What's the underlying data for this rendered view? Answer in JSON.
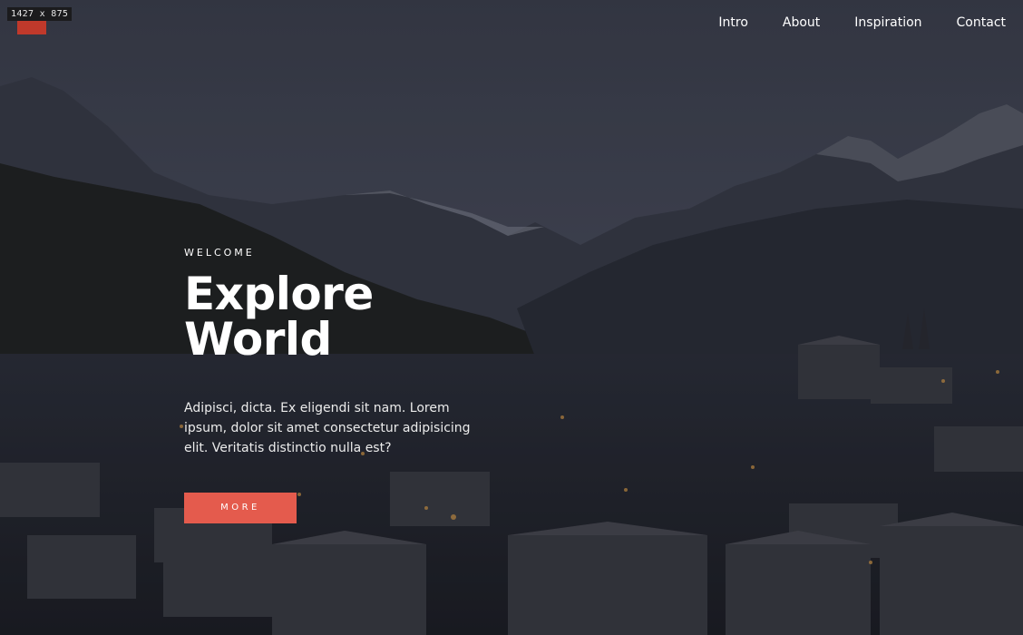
{
  "overlay": {
    "size_tag": "1427 x 875"
  },
  "nav": {
    "items": [
      {
        "label": "Intro"
      },
      {
        "label": "About"
      },
      {
        "label": "Inspiration"
      },
      {
        "label": "Contact"
      }
    ]
  },
  "hero": {
    "eyebrow": "WELCOME",
    "title": "Explore World",
    "description": "Adipisci, dicta. Ex eligendi sit nam. Lorem ipsum, dolor sit amet consectetur adipisicing elit. Veritatis distinctio nulla est?",
    "cta_label": "MORE"
  },
  "colors": {
    "accent": "#e45b4d",
    "sky": "#4a4f5e",
    "text": "#ffffff"
  }
}
